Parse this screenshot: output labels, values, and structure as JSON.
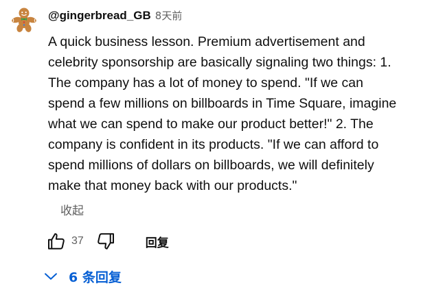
{
  "comment": {
    "author": "@gingerbread_GB",
    "time": "8天前",
    "text_lines": [
      "A quick business lesson. Premium advertisement and",
      "celebrity sponsorship are basically signaling two things: 1.",
      "The company has a lot of money to spend. \"If we can",
      "spend a few millions on billboards in Time Square, imagine",
      "what we can spend to make our product better!\" 2. The",
      "company is confident in its products. \"If we can afford to",
      "spend millions of dollars on billboards, we will definitely",
      "make that money back with our products.\""
    ],
    "collapse_label": "收起",
    "like_count": "37",
    "reply_label": "回复",
    "replies_toggle_label": "6 条回复"
  },
  "icons": {
    "avatar": "gingerbread-man-avatar",
    "like": "thumbs-up-icon",
    "dislike": "thumbs-down-icon",
    "expand": "chevron-down-icon"
  },
  "colors": {
    "text": "#0f0f0f",
    "secondary": "#606060",
    "link_blue": "#065fd4",
    "avatar_brown": "#c8843f"
  }
}
